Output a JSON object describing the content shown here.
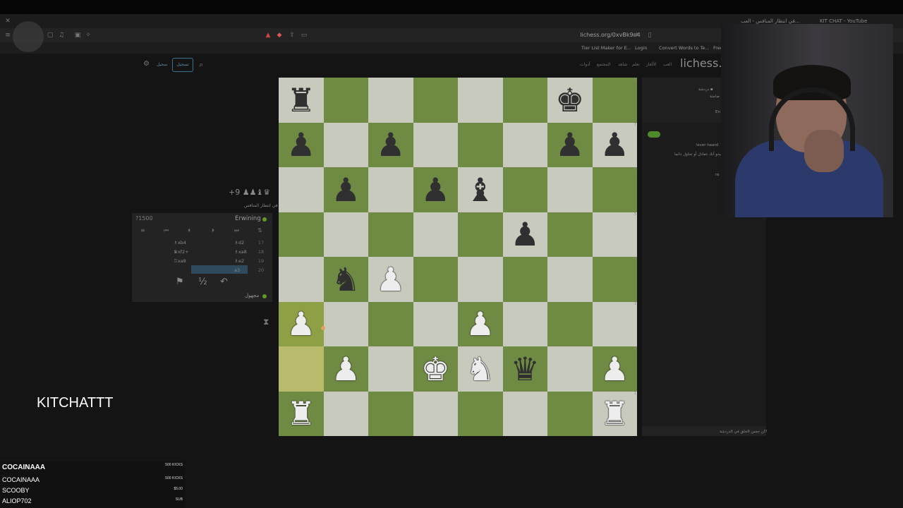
{
  "browser": {
    "tabs": [
      "في انتظار المنافس - العب...",
      "KIT CHAT - YouTube"
    ],
    "url": "lichess.org/0xvBk9n4",
    "bookmarks": [
      "Tier List Maker for E...",
      "Login",
      "Convert Words to Te...",
      "Free"
    ]
  },
  "lichess": {
    "logo": "lichess.o",
    "nav": [
      "العب",
      "الألغاز",
      "تعلم",
      "شاهد",
      "المجتمع",
      "أدوات"
    ],
    "signin_label": "تسجيل",
    "signup_label": "سجيل"
  },
  "board": {
    "pieces": [
      [
        "br",
        "",
        "",
        "",
        "",
        "",
        "bk",
        ""
      ],
      [
        "bp",
        "",
        "bp",
        "",
        "",
        "",
        "bp",
        "bp"
      ],
      [
        "",
        "bp",
        "",
        "bp",
        "bb",
        "",
        "",
        ""
      ],
      [
        "",
        "",
        "",
        "",
        "",
        "bp",
        "",
        ""
      ],
      [
        "",
        "bn",
        "wp",
        "",
        "",
        "",
        "",
        ""
      ],
      [
        "wp",
        "",
        "",
        "",
        "wp",
        "",
        "",
        ""
      ],
      [
        "",
        "wp",
        "",
        "wk",
        "wn",
        "bq",
        "",
        "wp"
      ],
      [
        "wr",
        "",
        "",
        "",
        "",
        "",
        "",
        "wr"
      ]
    ],
    "highlight": [
      [
        5,
        0
      ],
      [
        6,
        0
      ]
    ],
    "rank_labels": [
      "8",
      "7",
      "6",
      "5",
      "4",
      "3",
      "2",
      "1"
    ]
  },
  "game": {
    "material": "+9 ♟♟♝♛",
    "opening": "في انتظار المنافس",
    "rating_top": "?1500",
    "player_top": "Erwining",
    "player_bottom": "مجهول",
    "moves": [
      {
        "num": "17",
        "white": "♗d2",
        "black": "♗xb4"
      },
      {
        "num": "18",
        "white": "♗xa8",
        "black": "♛xf2+"
      },
      {
        "num": "19",
        "white": "♗e2",
        "black": "♖xa8"
      },
      {
        "num": "20",
        "white": "a3",
        "black": ""
      }
    ],
    "half_label": "½"
  },
  "chat": {
    "header_lines": [
      "دردشة ▪",
      "صامتة",
      "En"
    ],
    "messages": [
      "!ever heard",
      "يبدو أنك تتعادل أو تحاول دائما",
      "re"
    ],
    "input_placeholder": "كن حسن الخلق في الدردشة!"
  },
  "overlay": {
    "title": "KITCHATTT",
    "kicks": [
      {
        "name": "COCAINAAA",
        "value": "500 KICKS"
      },
      {
        "name": "COCAINAAA",
        "value": "500 KICKS"
      },
      {
        "name": "SCOOBY",
        "value": "$5.00"
      },
      {
        "name": "ALIOP702",
        "value": "SUB"
      }
    ]
  }
}
